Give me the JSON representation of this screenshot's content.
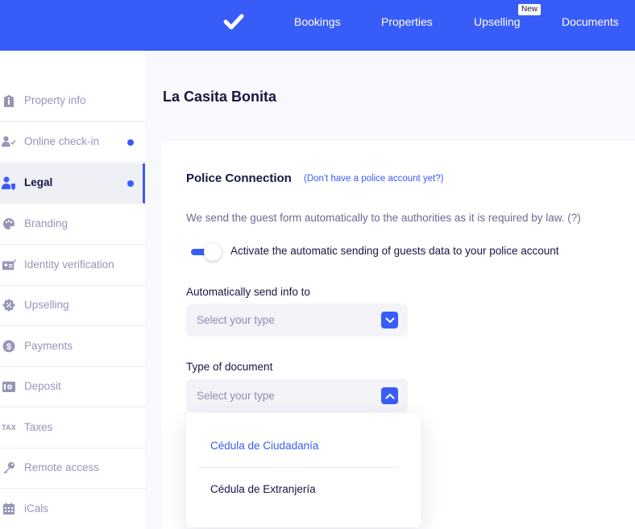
{
  "colors": {
    "accent": "#385cf8",
    "text_dark": "#161643",
    "text_muted": "#9696b9"
  },
  "nav": {
    "logo_icon": "checkmark-icon",
    "items": [
      "Bookings",
      "Properties",
      "Upselling",
      "Documents"
    ],
    "upselling_badge": "New"
  },
  "sidebar": {
    "items": [
      {
        "label": "Property info",
        "icon": "info-icon",
        "dot": false,
        "active": false
      },
      {
        "label": "Online check-in",
        "icon": "user-check-icon",
        "dot": true,
        "active": false
      },
      {
        "label": "Legal",
        "icon": "legal-icon",
        "dot": true,
        "active": true
      },
      {
        "label": "Branding",
        "icon": "palette-icon",
        "dot": false,
        "active": false
      },
      {
        "label": "Identity verification",
        "icon": "id-card-icon",
        "dot": false,
        "active": false
      },
      {
        "label": "Upselling",
        "icon": "percent-icon",
        "dot": false,
        "active": false
      },
      {
        "label": "Payments",
        "icon": "dollar-icon",
        "dot": false,
        "active": false
      },
      {
        "label": "Deposit",
        "icon": "safe-icon",
        "dot": false,
        "active": false
      },
      {
        "label": "Taxes",
        "icon": "tax-icon",
        "icon_text": "TAX",
        "dot": false,
        "active": false
      },
      {
        "label": "Remote access",
        "icon": "key-icon",
        "dot": false,
        "active": false
      },
      {
        "label": "iCals",
        "icon": "calendar-icon",
        "dot": false,
        "active": false
      }
    ]
  },
  "main": {
    "title": "La Casita Bonita",
    "section_title": "Police Connection",
    "section_link": "(Don't have a police account yet?)",
    "description": "We send the guest form automatically to the authorities as it is required by law. (?)",
    "toggle_label": "Activate the automatic sending of guests data to your police account",
    "toggle_on": true,
    "send_info_label": "Automatically send info to",
    "send_info_placeholder": "Select your type",
    "doc_type_label": "Type of document",
    "doc_type_placeholder": "Select your type",
    "doc_type_options": [
      "Cédula de Ciudadanía",
      "Cédula de Extranjería"
    ]
  }
}
